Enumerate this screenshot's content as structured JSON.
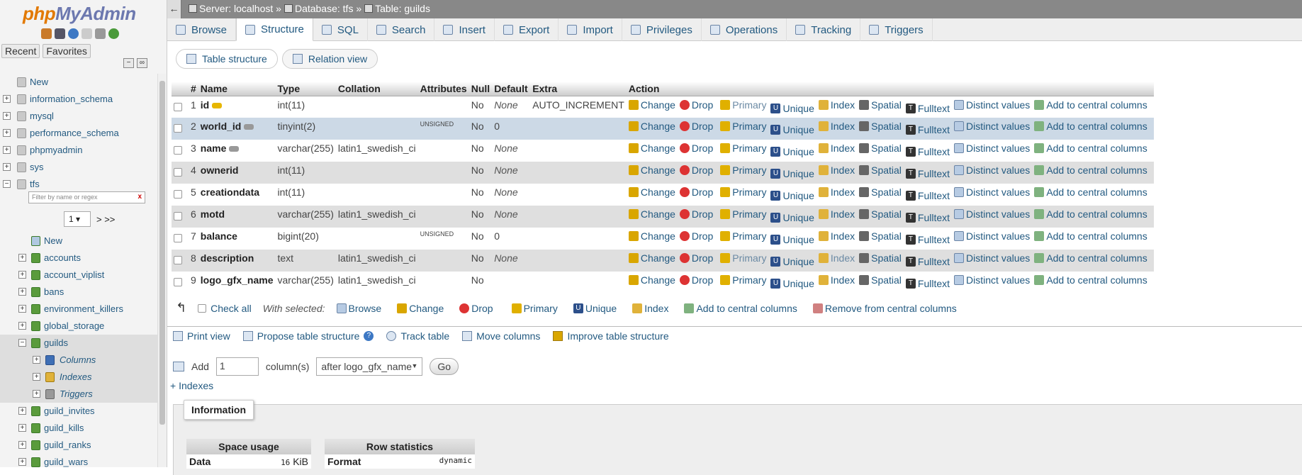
{
  "nav": {
    "logo_php": "php",
    "logo_my": "MyAdmin",
    "tabs": [
      "Recent",
      "Favorites"
    ],
    "filter_placeholder": "Filter by name or regex",
    "filter_clear": "x",
    "page": "1",
    "pager_next": "> >>",
    "items": [
      {
        "label": "New",
        "level": 0
      },
      {
        "label": "information_schema",
        "level": 0
      },
      {
        "label": "mysql",
        "level": 0
      },
      {
        "label": "performance_schema",
        "level": 0
      },
      {
        "label": "phpmyadmin",
        "level": 0
      },
      {
        "label": "sys",
        "level": 0
      },
      {
        "label": "tfs",
        "level": 0
      }
    ],
    "tfs_items": [
      {
        "label": "New"
      },
      {
        "label": "accounts"
      },
      {
        "label": "account_viplist"
      },
      {
        "label": "bans"
      },
      {
        "label": "environment_killers"
      },
      {
        "label": "global_storage"
      },
      {
        "label": "guilds"
      }
    ],
    "guilds_children": [
      "Columns",
      "Indexes",
      "Triggers"
    ],
    "after_items": [
      "guild_invites",
      "guild_kills",
      "guild_ranks",
      "guild_wars"
    ]
  },
  "breadcrumb": {
    "server": "Server: localhost »",
    "database": "Database: tfs »",
    "table": "Table: guilds"
  },
  "tabs": [
    "Browse",
    "Structure",
    "SQL",
    "Search",
    "Insert",
    "Export",
    "Import",
    "Privileges",
    "Operations",
    "Tracking",
    "Triggers"
  ],
  "active_tab": "Structure",
  "subtabs": [
    "Table structure",
    "Relation view"
  ],
  "table": {
    "headers": [
      "#",
      "Name",
      "Type",
      "Collation",
      "Attributes",
      "Null",
      "Default",
      "Extra",
      "Action"
    ],
    "rows": [
      {
        "n": "1",
        "name": "id",
        "type": "int(11)",
        "collation": "",
        "attributes": "",
        "null": "No",
        "default": "None",
        "extra": "AUTO_INCREMENT",
        "key": "primary"
      },
      {
        "n": "2",
        "name": "world_id",
        "type": "tinyint(2)",
        "collation": "",
        "attributes": "UNSIGNED",
        "null": "No",
        "default": "0",
        "extra": "",
        "key": "index"
      },
      {
        "n": "3",
        "name": "name",
        "type": "varchar(255)",
        "collation": "latin1_swedish_ci",
        "attributes": "",
        "null": "No",
        "default": "None",
        "extra": "",
        "key": "index"
      },
      {
        "n": "4",
        "name": "ownerid",
        "type": "int(11)",
        "collation": "",
        "attributes": "",
        "null": "No",
        "default": "None",
        "extra": "",
        "key": ""
      },
      {
        "n": "5",
        "name": "creationdata",
        "type": "int(11)",
        "collation": "",
        "attributes": "",
        "null": "No",
        "default": "None",
        "extra": "",
        "key": ""
      },
      {
        "n": "6",
        "name": "motd",
        "type": "varchar(255)",
        "collation": "latin1_swedish_ci",
        "attributes": "",
        "null": "No",
        "default": "None",
        "extra": "",
        "key": ""
      },
      {
        "n": "7",
        "name": "balance",
        "type": "bigint(20)",
        "collation": "",
        "attributes": "UNSIGNED",
        "null": "No",
        "default": "0",
        "extra": "",
        "key": ""
      },
      {
        "n": "8",
        "name": "description",
        "type": "text",
        "collation": "latin1_swedish_ci",
        "attributes": "",
        "null": "No",
        "default": "None",
        "extra": "",
        "key": ""
      },
      {
        "n": "9",
        "name": "logo_gfx_name",
        "type": "varchar(255)",
        "collation": "latin1_swedish_ci",
        "attributes": "",
        "null": "No",
        "default": "",
        "extra": "",
        "key": ""
      }
    ],
    "actions": [
      "Change",
      "Drop",
      "Primary",
      "Unique",
      "Index",
      "Spatial",
      "Fulltext",
      "Distinct values",
      "Add to central columns"
    ]
  },
  "bulk": {
    "check_all": "Check all",
    "with_selected": "With selected:",
    "actions": [
      "Browse",
      "Change",
      "Drop",
      "Primary",
      "Unique",
      "Index",
      "Add to central columns",
      "Remove from central columns"
    ]
  },
  "links": {
    "print": "Print view",
    "propose": "Propose table structure",
    "track": "Track table",
    "move": "Move columns",
    "improve": "Improve table structure"
  },
  "add": {
    "label": "Add",
    "count": "1",
    "unit": "column(s)",
    "position": "after logo_gfx_name",
    "go": "Go"
  },
  "indexes_link": "+ Indexes",
  "info": {
    "legend": "Information",
    "space_title": "Space usage",
    "space_label": "Data",
    "space_value": "16",
    "space_unit": "KiB",
    "row_title": "Row statistics",
    "row_label": "Format",
    "row_value": "dynamic"
  }
}
